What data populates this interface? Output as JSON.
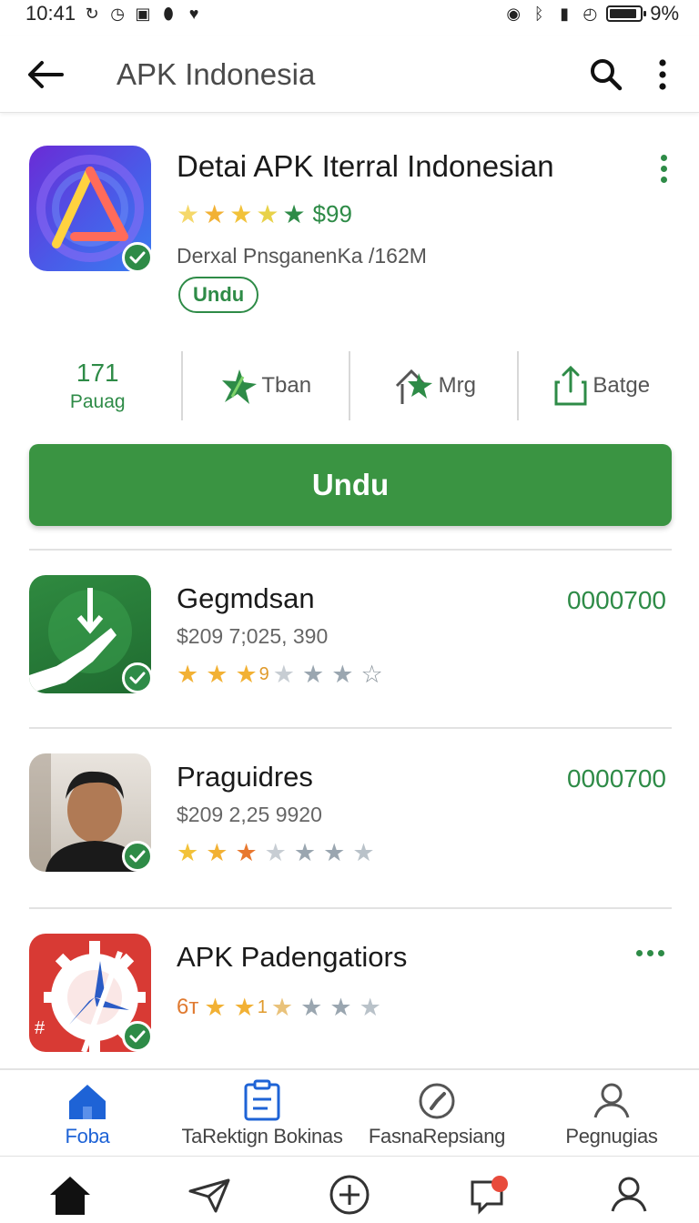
{
  "status_bar": {
    "time": "10:41",
    "battery": "9%"
  },
  "app_bar": {
    "title": "APK Indonesia"
  },
  "hero": {
    "title": "Detai APK Iterral Indonesian",
    "rating_value": 5,
    "price": "$99",
    "meta": "Derxal PnsganenKa /162M",
    "pill_label": "Undu"
  },
  "stats": {
    "count": "171",
    "count_label": "Pauag",
    "action1": "Tban",
    "action2": "Mrg",
    "action3": "Batge"
  },
  "main_button": {
    "label": "Undu"
  },
  "list": [
    {
      "title": "Gegmdsan",
      "price": "0000700",
      "meta": "$209 7;025, 390",
      "rating_label": "9"
    },
    {
      "title": "Praguidres",
      "price": "0000700",
      "meta": "$209 2,25 9920"
    },
    {
      "title": "APK Padengatiors",
      "rating_prefix": "6т",
      "rating_label": "1"
    }
  ],
  "bottom_nav": [
    {
      "label": "Foba",
      "icon": "home-icon"
    },
    {
      "label": "TaRektign Bokinas",
      "icon": "clipboard-icon"
    },
    {
      "label": "FasnaRepsiang",
      "icon": "compass-icon"
    },
    {
      "label": "Pegnugias",
      "icon": "person-icon"
    }
  ],
  "colors": {
    "green": "#2e8b47",
    "button_green": "#3a9442",
    "blue": "#1e63d6",
    "star_gold": "#f2b134"
  }
}
